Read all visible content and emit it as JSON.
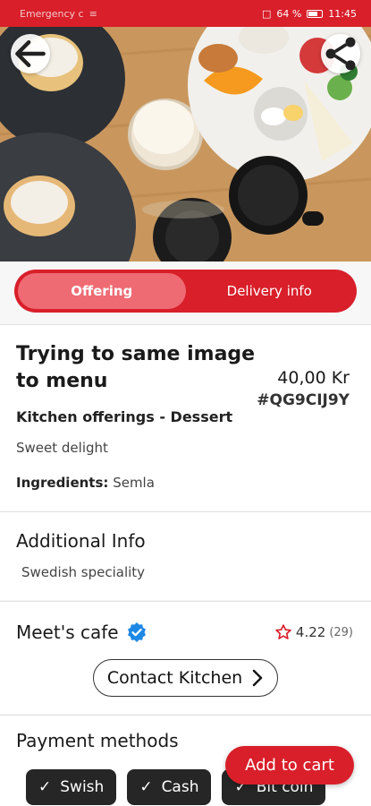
{
  "status_bar": {
    "carrier": "Emergency c",
    "battery": "64 %",
    "time": "11:45"
  },
  "header": {
    "back_icon": "arrow-left-icon",
    "share_icon": "share-icon"
  },
  "tabs": [
    {
      "label": "Offering",
      "active": true
    },
    {
      "label": "Delivery info",
      "active": false
    }
  ],
  "item": {
    "title": "Trying to same image to menu",
    "price": "40,00 Kr",
    "code": "#QG9CIJ9Y",
    "category": "Kitchen offerings - Dessert",
    "description": "Sweet delight",
    "ingredients_label": "Ingredients:",
    "ingredients_value": "Semla"
  },
  "additional_info": {
    "title": "Additional Info",
    "text": "Swedish speciality"
  },
  "kitchen": {
    "name": "Meet's cafe",
    "rating": "4.22",
    "rating_count": "(29)",
    "contact_label": "Contact Kitchen"
  },
  "payment": {
    "title": "Payment methods",
    "methods": [
      "Swish",
      "Cash",
      "Bit coin"
    ]
  },
  "cart": {
    "add_label": "Add to cart"
  },
  "colors": {
    "accent": "#d81f2a",
    "accent_light": "#ef6b73",
    "chip_bg": "#262626",
    "verified": "#1e88e5"
  }
}
